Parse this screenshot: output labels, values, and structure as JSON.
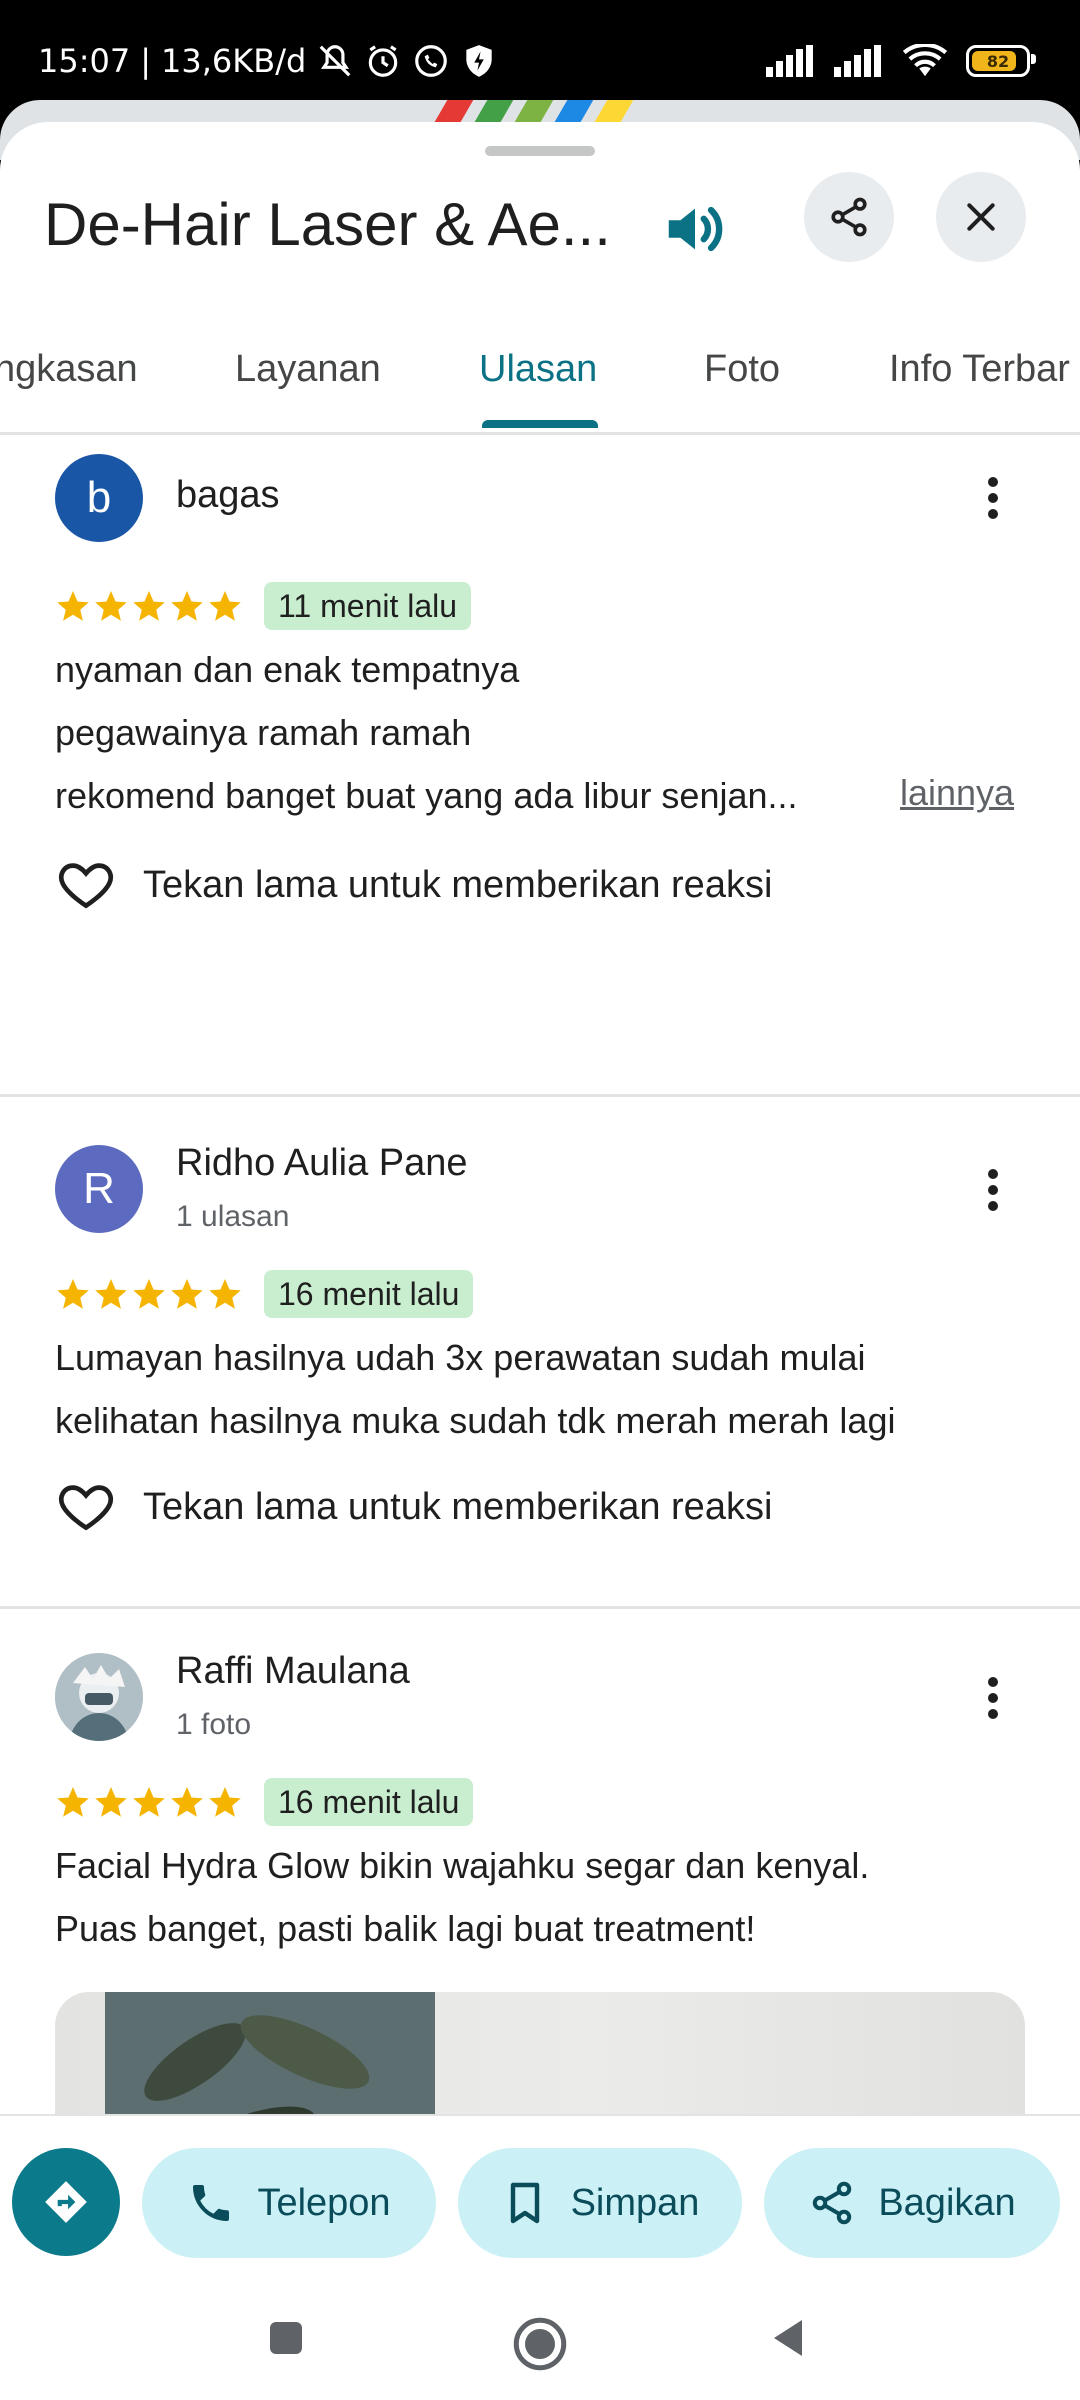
{
  "status_bar": {
    "time": "15:07",
    "net_speed": "13,6KB/d",
    "battery_level": "82",
    "icons": [
      "silent-icon",
      "alarm-icon",
      "whatsapp-icon",
      "shield-icon",
      "signal-icon",
      "signal-icon",
      "wifi-icon",
      "battery-icon"
    ]
  },
  "header": {
    "title": "De-Hair Laser & Ae...",
    "icons": [
      "speaker-icon",
      "share-icon",
      "close-icon"
    ]
  },
  "tabs": [
    {
      "label": "ngkasan"
    },
    {
      "label": "Layanan"
    },
    {
      "label": "Ulasan",
      "active": true
    },
    {
      "label": "Foto"
    },
    {
      "label": "Info Terbar"
    }
  ],
  "reviews": [
    {
      "initial": "b",
      "avatar_color": "#1a56a6",
      "name": "bagas",
      "sub": "",
      "stars": 5,
      "time": "11 menit lalu",
      "lines": [
        "nyaman dan enak tempatnya",
        "pegawainya ramah ramah",
        "rekomend banget buat yang ada libur senjan..."
      ],
      "more_link": "lainnya",
      "reaction": "Tekan lama untuk memberikan reaksi"
    },
    {
      "initial": "R",
      "avatar_color": "#5c6bc0",
      "name": "Ridho Aulia Pane",
      "sub": "1 ulasan",
      "stars": 5,
      "time": "16 menit lalu",
      "lines": [
        "Lumayan hasilnya udah 3x perawatan sudah mulai",
        "kelihatan hasilnya muka sudah tdk merah merah lagi"
      ],
      "reaction": "Tekan lama untuk memberikan reaksi"
    },
    {
      "initial": "",
      "avatar_color": "#cfd8dc",
      "name": "Raffi Maulana",
      "sub": "1 foto",
      "stars": 5,
      "time": "16 menit lalu",
      "lines": [
        "Facial Hydra Glow bikin wajahku segar dan kenyal.",
        "Puas banget, pasti balik lagi buat treatment!"
      ]
    }
  ],
  "actions": {
    "directions_icon": "directions-icon",
    "call": "Telepon",
    "save": "Simpan",
    "share": "Bagikan"
  },
  "colors": {
    "accent": "#0b7285",
    "chip": "#c9eecf",
    "pill": "#cbf0f6",
    "star": "#f4b400"
  }
}
